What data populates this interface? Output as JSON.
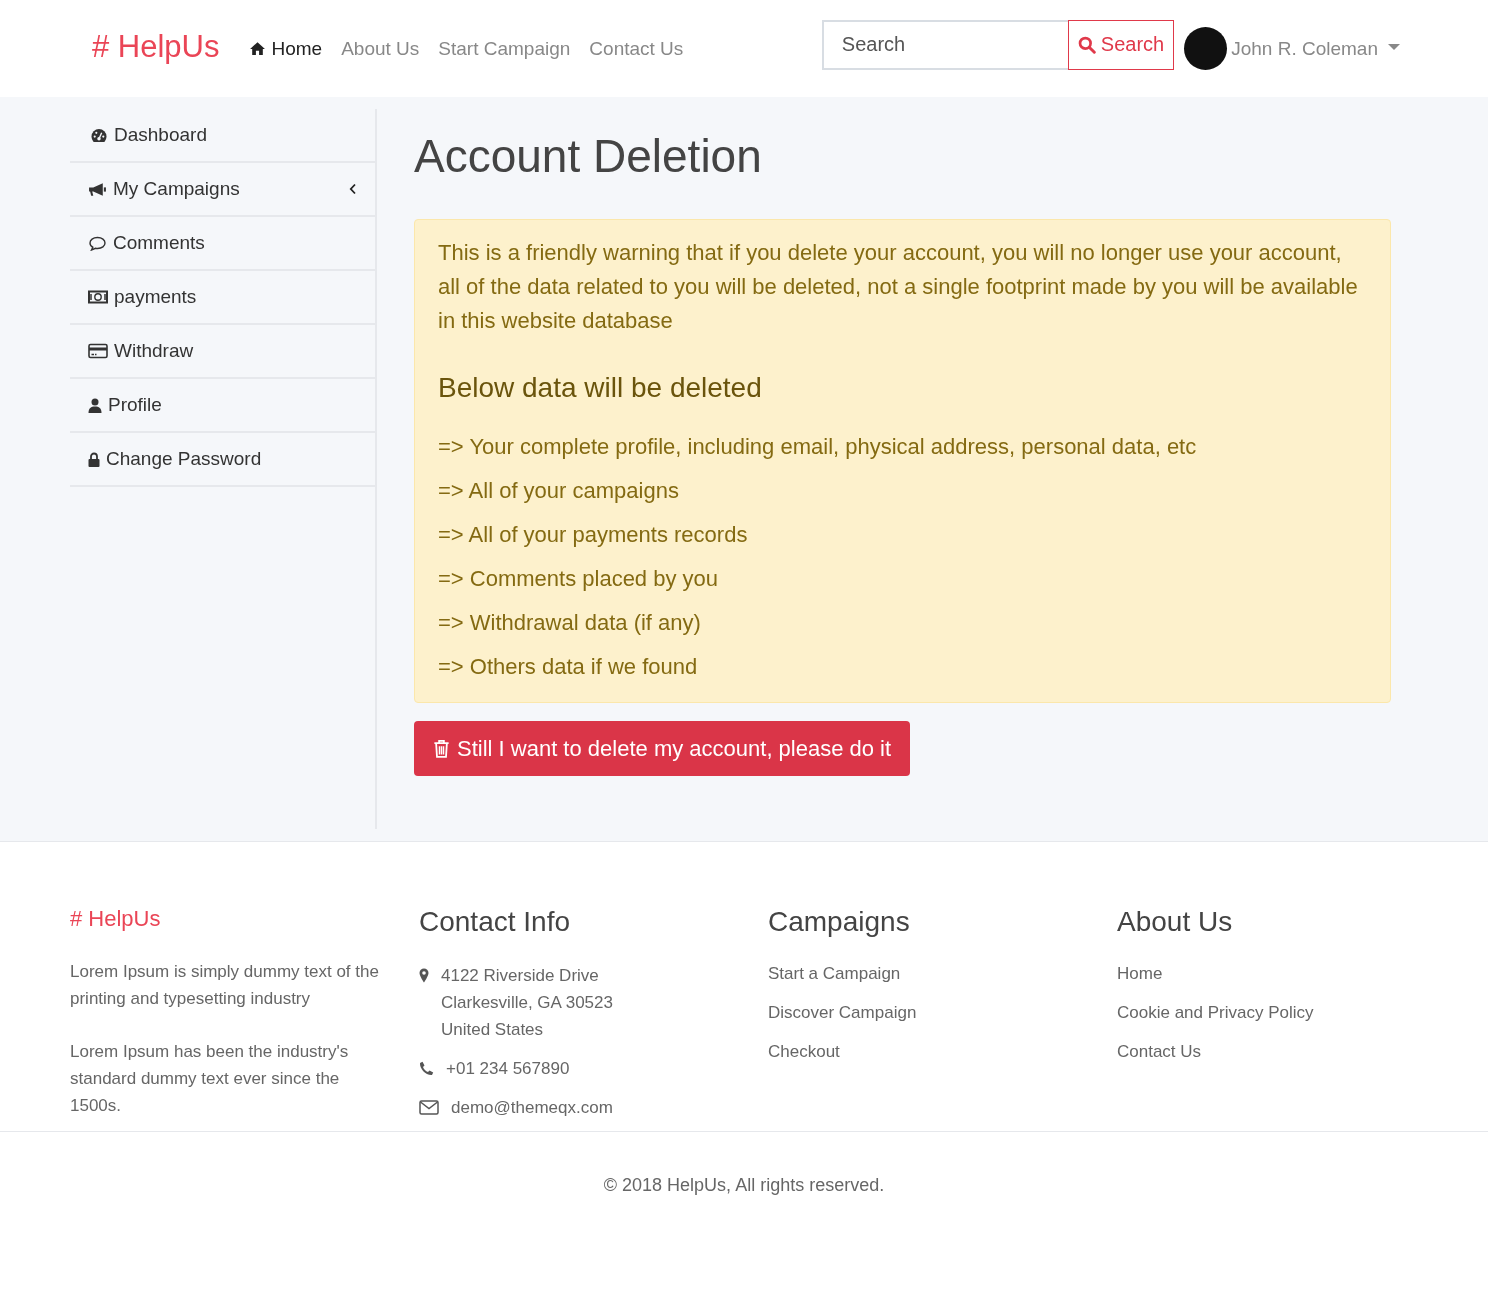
{
  "navbar": {
    "brand": "# HelpUs",
    "links": [
      {
        "label": "Home",
        "selected": true
      },
      {
        "label": "About Us",
        "selected": false
      },
      {
        "label": "Start Campaign",
        "selected": false
      },
      {
        "label": "Contact Us",
        "selected": false
      }
    ],
    "search": {
      "placeholder": "Search",
      "button": "Search"
    },
    "user": {
      "name": "John R. Coleman"
    }
  },
  "sidebar": {
    "items": [
      {
        "label": "Dashboard",
        "kind": "link"
      },
      {
        "label": "My Campaigns",
        "kind": "submenu"
      },
      {
        "label": "Comments",
        "kind": "link"
      },
      {
        "label": "payments",
        "kind": "link"
      },
      {
        "label": "Withdraw",
        "kind": "link"
      },
      {
        "label": "Profile",
        "kind": "link"
      },
      {
        "label": "Change Password",
        "kind": "link"
      }
    ]
  },
  "page": {
    "title": "Account Deletion",
    "warning": {
      "intro": "This is a friendly warning that if you delete your account, you will no longer use your account, all of the data related to you will be deleted, not a single footprint made by you will be available in this website database",
      "heading": "Below data will be deleted",
      "items": [
        "=> Your complete profile, including email, physical address, personal data, etc",
        "=> All of your campaigns",
        "=> All of your payments records",
        "=> Comments placed by you",
        "=> Withdrawal data (if any)",
        "=> Others data if we found"
      ]
    },
    "delete_button": "Still I want to delete my account, please do it"
  },
  "footer": {
    "brand": "# HelpUs",
    "paragraphs": [
      "Lorem Ipsum is simply dummy text of the printing and typesetting industry",
      "Lorem Ipsum has been the industry's standard dummy text ever since the 1500s."
    ],
    "columns": [
      {
        "title": "Contact Info",
        "kind": "contacts",
        "items": [
          {
            "lines": [
              "4122 Riverside Drive",
              "Clarkesville, GA 30523",
              "United States"
            ]
          },
          {
            "lines": [
              "+01 234 567890"
            ]
          },
          {
            "lines": [
              "demo@themeqx.com"
            ]
          }
        ]
      },
      {
        "title": "Campaigns",
        "kind": "links",
        "items": [
          {
            "lines": [
              "Start a Campaign"
            ]
          },
          {
            "lines": [
              "Discover Campaign"
            ]
          },
          {
            "lines": [
              "Checkout"
            ]
          }
        ]
      },
      {
        "title": "About Us",
        "kind": "links",
        "items": [
          {
            "lines": [
              "Home"
            ]
          },
          {
            "lines": [
              "Cookie and Privacy Policy"
            ]
          },
          {
            "lines": [
              "Contact Us"
            ]
          }
        ]
      }
    ],
    "copyright": "© 2018 HelpUs, All rights reserved."
  }
}
